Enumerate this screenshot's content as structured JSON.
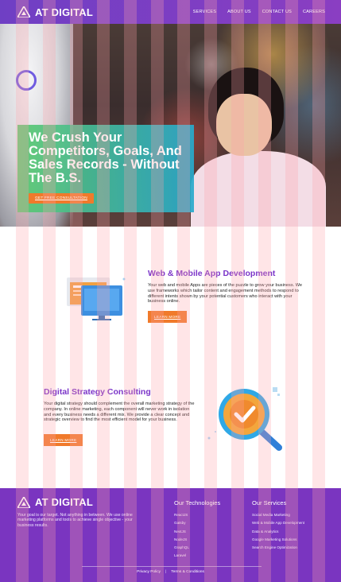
{
  "brand": {
    "name": "AT DIGITAL"
  },
  "nav": [
    {
      "label": "SERVICES"
    },
    {
      "label": "ABOUT US"
    },
    {
      "label": "CONTACT US"
    },
    {
      "label": "CAREERS"
    }
  ],
  "hero": {
    "title": "We Crush Your Competitors, Goals, And Sales Records - Without The B.S.",
    "cta": "GET FREE CONSULTATION"
  },
  "services": [
    {
      "title": "Web & Mobile App Development",
      "text": "Your web and mobile Apps are pieces of the puzzle to grow your business. We use frameworks which tailor content and engagement methods to respond to different intents shown by your potential customers who interact with your business online.",
      "button": "LEARN MORE",
      "icon": "monitor-icon"
    },
    {
      "title": "Digital Strategy Consulting",
      "text": "Your digital strategy should complement the overall marketing strategy of the company. In online marketing, each component will never work in isolation and every business needs a different mix. We provide a clear concept and strategic overview to find the most efficient model for your business.",
      "button": "LEARN MORE",
      "icon": "magnifier-check-icon"
    }
  ],
  "footer": {
    "brand": "AT DIGITAL",
    "about": "Your goal is our target. Not anything in between. We use online marketing platforms and tools to achieve single objective - your business results.",
    "tech_title": "Our Technologies",
    "tech": [
      "ReactJS",
      "Gatsby",
      "NextJS",
      "NodeJS",
      "GraphQL",
      "Laravel"
    ],
    "services_title": "Our Services",
    "services": [
      "Social Media Marketing",
      "Web & Mobile App Development",
      "Data & Analytics",
      "Google Marketing Solutions",
      "Search Engine Optimization"
    ],
    "links": [
      "Privacy Policy",
      "Terms & Conditions"
    ],
    "separator": "|"
  },
  "colors": {
    "brand_purple": "#7a35c0",
    "accent_orange": "#f07a2b",
    "title_purple": "#7b35c9"
  }
}
